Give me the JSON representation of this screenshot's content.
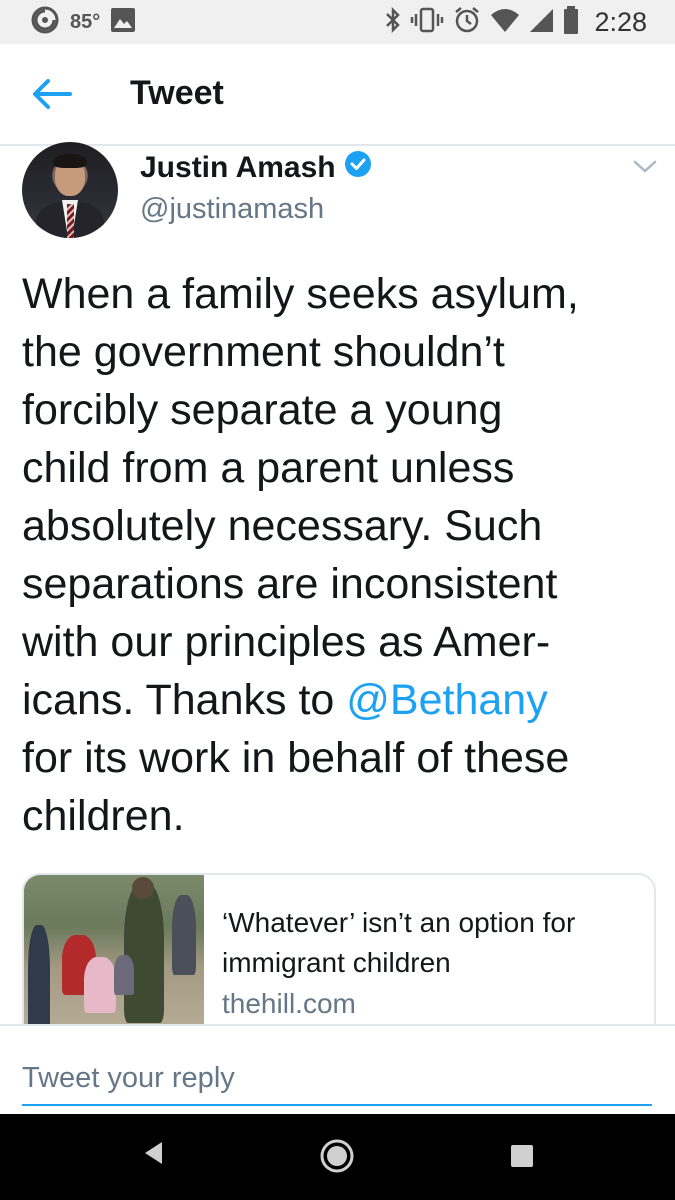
{
  "status_bar": {
    "temperature": "85°",
    "time": "2:28",
    "icons": [
      "location-icon",
      "image-icon",
      "bluetooth-icon",
      "vibrate-icon",
      "alarm-icon",
      "wifi-icon",
      "signal-icon",
      "battery-icon"
    ]
  },
  "header": {
    "title": "Tweet",
    "back_icon": "arrow-left-icon"
  },
  "tweet": {
    "display_name": "Justin Amash",
    "verified": true,
    "handle": "@justinamash",
    "text_lines": [
      "When a family seeks asylum,",
      "the government shouldn’t",
      "forcibly separate a young",
      "child from a parent unless",
      "absolutely necessary. Such",
      "separations are inconsistent",
      "with our principles as Amer-"
    ],
    "line8_before": "icans. Thanks to ",
    "mention": "@Bethany",
    "text_lines_end": [
      "for its work in behalf of these",
      "children."
    ]
  },
  "link_card": {
    "title": "‘Whatever’ isn’t an option for immigrant children",
    "domain": "thehill.com"
  },
  "reply": {
    "placeholder": "Tweet your reply"
  },
  "colors": {
    "accent": "#1da1f2",
    "secondary_text": "#657786",
    "border": "#e1e8ed"
  }
}
